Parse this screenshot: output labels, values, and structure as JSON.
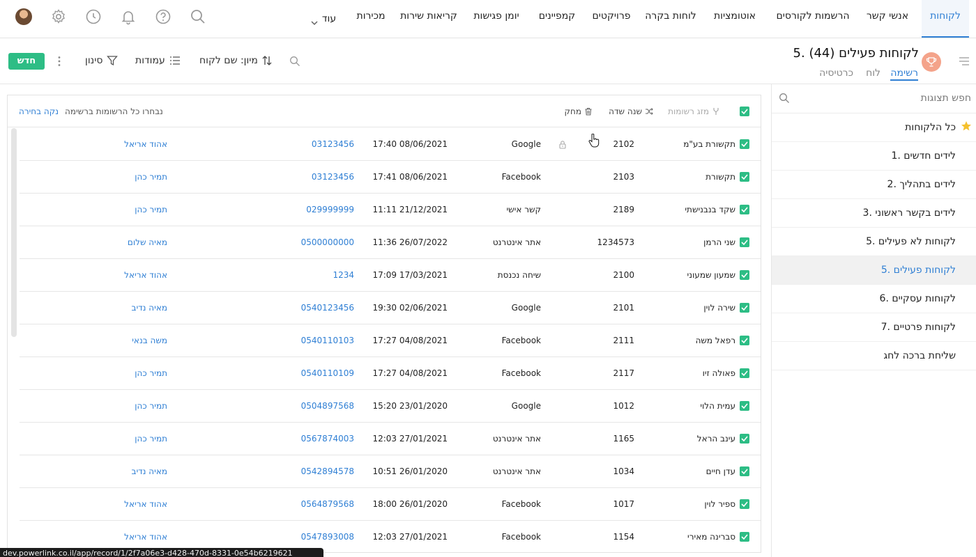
{
  "topnav": {
    "items": [
      {
        "label": "לקוחות",
        "active": true
      },
      {
        "label": "אנשי קשר"
      },
      {
        "label": "הרשמות לקורסים"
      },
      {
        "label": "אוטומציות"
      },
      {
        "label": "לוחות בקרה"
      },
      {
        "label": "פרויקטים"
      },
      {
        "label": "קמפיינים"
      },
      {
        "label": "יומן פגישות"
      },
      {
        "label": "קריאות שירות"
      },
      {
        "label": "מכירות"
      },
      {
        "label": "עוד"
      }
    ],
    "icons": [
      "search-icon",
      "help-icon",
      "bell-icon",
      "clock-icon",
      "settings-icon"
    ]
  },
  "header": {
    "title": "5. לקוחות פעילים (44)",
    "tabs": [
      {
        "label": "רשימה",
        "active": true
      },
      {
        "label": "לוח"
      },
      {
        "label": "כרטיסיה"
      }
    ],
    "tools": {
      "sort": "מיון: שם לקוח",
      "columns": "עמודות",
      "filter": "סינון",
      "new": "חדש"
    }
  },
  "sidebar": {
    "search_placeholder": "חפש תצוגות",
    "items": [
      {
        "label": "כל הלקוחות",
        "starred": true
      },
      {
        "label": "1. לידים חדשים"
      },
      {
        "label": "2. לידים בתהליך"
      },
      {
        "label": "3. לידים בקשר ראשוני"
      },
      {
        "label": "5. לקוחות לא פעילים"
      },
      {
        "label": "5. לקוחות פעילים",
        "active": true
      },
      {
        "label": "6. לקוחות עסקיים"
      },
      {
        "label": "7. לקוחות פרטיים"
      },
      {
        "label": "שליחת ברכה לחג"
      }
    ]
  },
  "list": {
    "bulk_actions": {
      "merge": "מזג רשומות",
      "change_field": "שנה שדה",
      "delete": "מחק"
    },
    "selection_info": "נבחרו כל הרשומות ברשימה",
    "clear_selection": "נקה בחירה",
    "rows": [
      {
        "name": "תקשורת בע\"מ",
        "number": "2102",
        "source": "Google",
        "date": "17:40 08/06/2021",
        "phone": "03123456",
        "owner": "אהוד אריאל",
        "locked": true
      },
      {
        "name": "תקשורת",
        "number": "2103",
        "source": "Facebook",
        "date": "17:41 08/06/2021",
        "phone": "03123456",
        "owner": "תמיר כהן"
      },
      {
        "name": "שקד בנבנישתי",
        "number": "2189",
        "source": "קשר אישי",
        "date": "11:11 21/12/2021",
        "phone": "029999999",
        "owner": "תמיר כהן"
      },
      {
        "name": "שני הרמן",
        "number": "1234573",
        "source": "אתר אינטרנט",
        "date": "11:36 26/07/2022",
        "phone": "0500000000",
        "owner": "מאיה שלום"
      },
      {
        "name": "שמעון שמעוני",
        "number": "2100",
        "source": "שיחה נכנסת",
        "date": "17:09 17/03/2021",
        "phone": "1234",
        "owner": "אהוד אריאל"
      },
      {
        "name": "שירה לוין",
        "number": "2101",
        "source": "Google",
        "date": "19:30 02/06/2021",
        "phone": "0540123456",
        "owner": "מאיה נדיב"
      },
      {
        "name": "רפאל משה",
        "number": "2111",
        "source": "Facebook",
        "date": "17:27 04/08/2021",
        "phone": "0540110103",
        "owner": "משה בנאי"
      },
      {
        "name": "פאולה זיו",
        "number": "2117",
        "source": "Facebook",
        "date": "17:27 04/08/2021",
        "phone": "0540110109",
        "owner": "תמיר כהן"
      },
      {
        "name": "עמית הלוי",
        "number": "1012",
        "source": "Google",
        "date": "15:20 23/01/2020",
        "phone": "0504897568",
        "owner": "תמיר כהן"
      },
      {
        "name": "עינב הראל",
        "number": "1165",
        "source": "אתר אינטרנט",
        "date": "12:03 27/01/2021",
        "phone": "0567874003",
        "owner": "תמיר כהן"
      },
      {
        "name": "עדן חיים",
        "number": "1034",
        "source": "אתר אינטרנט",
        "date": "10:51 26/01/2020",
        "phone": "0542894578",
        "owner": "מאיה נדיב"
      },
      {
        "name": "ספיר לוין",
        "number": "1017",
        "source": "Facebook",
        "date": "18:00 26/01/2020",
        "phone": "0564879568",
        "owner": "אהוד אריאל"
      },
      {
        "name": "סברינה מאירי",
        "number": "1154",
        "source": "Facebook",
        "date": "12:03 27/01/2021",
        "phone": "0547893008",
        "owner": "אהוד אריאל"
      }
    ]
  },
  "status_url": "dev.powerlink.co.il/app/record/1/2f7a06e3-d428-470d-8331-0e54b6219621",
  "colors": {
    "accent": "#2f7fd4",
    "checkbox": "#2dbd85",
    "trophy": "#f4a38a"
  }
}
